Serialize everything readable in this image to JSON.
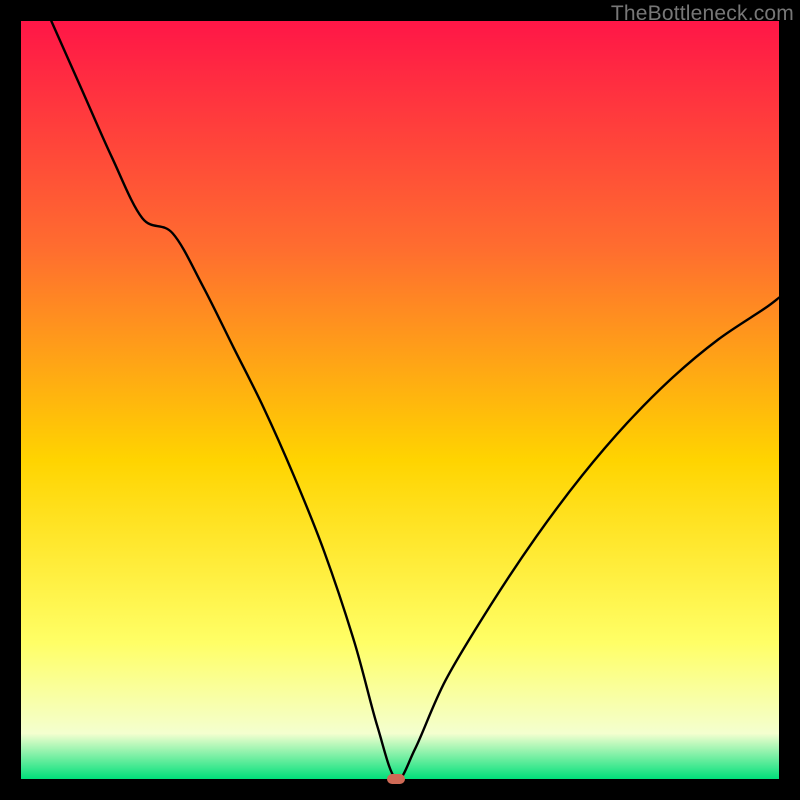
{
  "watermark": {
    "text": "TheBottleneck.com"
  },
  "marker": {
    "color": "#cf6a56",
    "x_percent": 49.5,
    "y_percent": 0
  },
  "gradient_colors": {
    "top": "#ff1647",
    "upper_orange": "#ff6d2f",
    "mid_yellow": "#ffd400",
    "lower_yellow": "#ffff66",
    "pale": "#f4ffcf",
    "green": "#00e07a"
  },
  "chart_data": {
    "type": "line",
    "title": "",
    "xlabel": "",
    "ylabel": "",
    "xlim": [
      0,
      100
    ],
    "ylim": [
      0,
      100
    ],
    "grid": false,
    "legend": false,
    "series": [
      {
        "name": "bottleneck-curve",
        "x": [
          4,
          8,
          12,
          16,
          20,
          24,
          28,
          32,
          36,
          40,
          44,
          47,
          49.5,
          52,
          56,
          62,
          68,
          74,
          80,
          86,
          92,
          98,
          100
        ],
        "y": [
          100,
          91,
          82,
          74,
          72,
          65,
          57,
          49,
          40,
          30,
          18,
          7,
          0,
          4,
          13,
          23,
          32,
          40,
          47,
          53,
          58,
          62,
          63.5
        ]
      }
    ],
    "annotations": [
      {
        "type": "marker",
        "x": 49.5,
        "y": 0,
        "shape": "pill",
        "color": "#cf6a56"
      }
    ]
  }
}
